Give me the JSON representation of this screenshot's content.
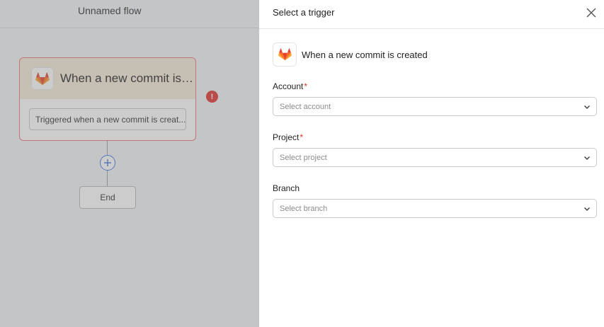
{
  "canvas": {
    "flow_title": "Unnamed flow",
    "trigger_node": {
      "title": "When a new commit is cr...",
      "description": "Triggered when a new commit is creat...",
      "error_glyph": "!"
    },
    "add_step_glyph": "+",
    "end_label": "End"
  },
  "panel": {
    "title": "Select a trigger",
    "app_icon": "gitlab-icon",
    "trigger_name": "When a new commit is created",
    "fields": [
      {
        "label": "Account",
        "required": "*",
        "placeholder": "Select account"
      },
      {
        "label": "Project",
        "required": "*",
        "placeholder": "Select project"
      },
      {
        "label": "Branch",
        "required": "",
        "placeholder": "Select branch"
      }
    ]
  },
  "colors": {
    "error": "#e0312f",
    "accent": "#3d78e0",
    "node_border": "#ee7373",
    "node_header": "#f6ead8"
  }
}
